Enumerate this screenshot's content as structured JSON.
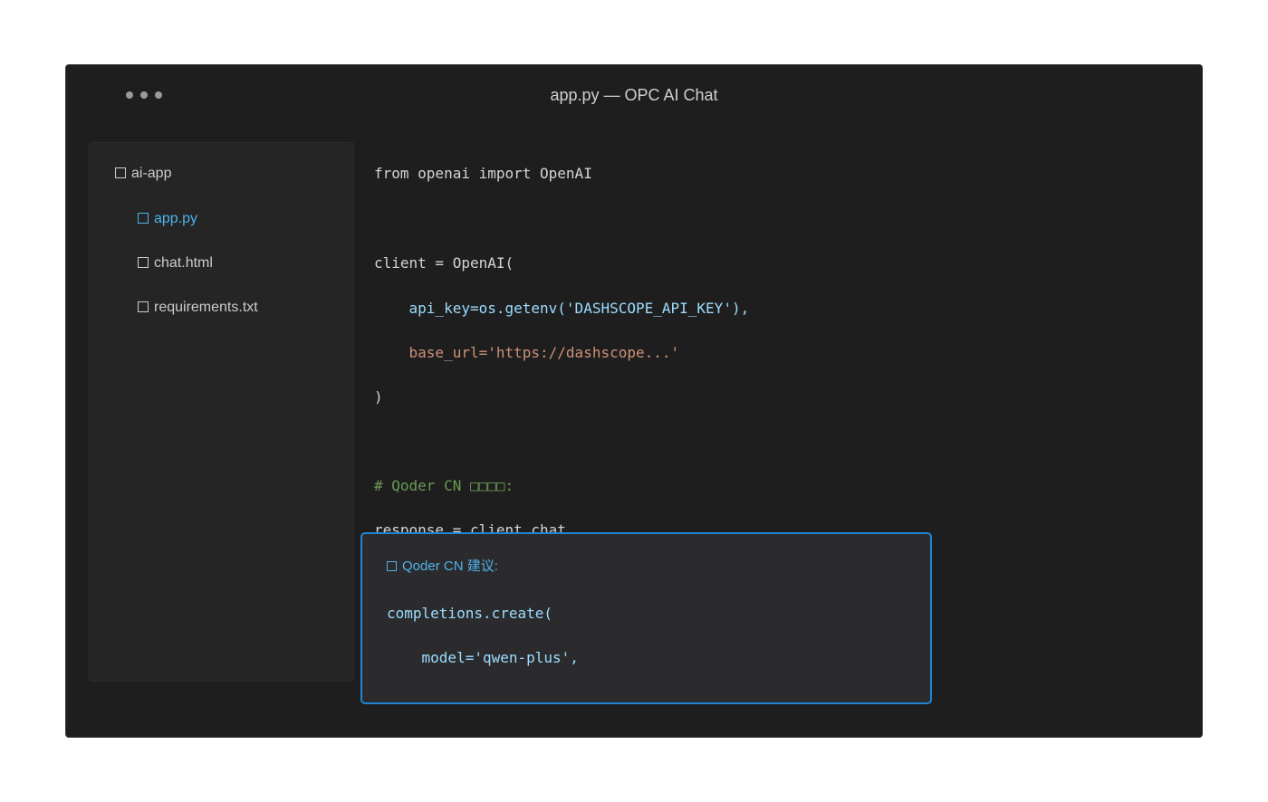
{
  "window": {
    "title": "app.py — OPC AI Chat"
  },
  "sidebar": {
    "items": [
      {
        "label": "ai-app",
        "icon": "folder-icon",
        "active": false
      },
      {
        "label": "app.py",
        "icon": "file-icon",
        "active": true
      },
      {
        "label": "chat.html",
        "icon": "file-icon",
        "active": false
      },
      {
        "label": "requirements.txt",
        "icon": "file-icon",
        "active": false
      }
    ]
  },
  "editor": {
    "lines": [
      "from openai import OpenAI",
      "client = OpenAI(",
      "    api_key=os.getenv('DASHSCOPE_API_KEY'),",
      "    base_url='https://dashscope...'",
      ")",
      "# Qoder CN □□□□:",
      "response = client.chat."
    ]
  },
  "suggestion": {
    "header": "Qoder CN 建议:",
    "lines": [
      "completions.create(",
      "    model='qwen-plus',"
    ]
  },
  "colors": {
    "accent": "#1f86d6",
    "active_text": "#4fb3e8",
    "comment": "#6a9955",
    "string": "#ce9178",
    "identifier": "#9cdcfe"
  }
}
